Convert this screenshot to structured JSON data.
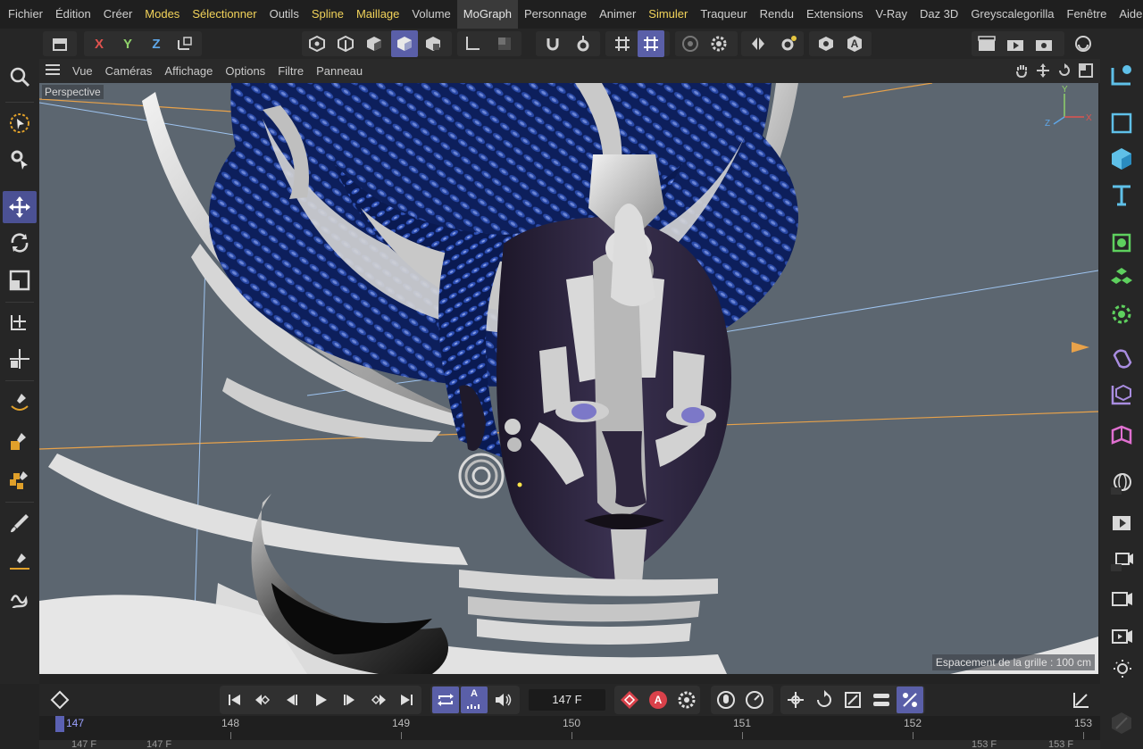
{
  "menu": [
    "Fichier",
    "Édition",
    "Créer",
    "Modes",
    "Sélectionner",
    "Outils",
    "Spline",
    "Maillage",
    "Volume",
    "MoGraph",
    "Personnage",
    "Animer",
    "Simuler",
    "Traqueur",
    "Rendu",
    "Extensions",
    "V-Ray",
    "Daz 3D",
    "Greyscalegorilla",
    "Fenêtre",
    "Aide"
  ],
  "toolbar": {
    "x_label": "X",
    "y_label": "Y",
    "z_label": "Z",
    "a_label": "A"
  },
  "viewport_menu": [
    "Vue",
    "Caméras",
    "Affichage",
    "Options",
    "Filtre",
    "Panneau"
  ],
  "viewport": {
    "camera_label": "Perspective",
    "space_label": "Espacement de la grille : 100 cm",
    "axis_y": "Y",
    "axis_x": "X",
    "axis_z": "Z"
  },
  "timeline": {
    "current_frame": "147 F",
    "record_label": "A",
    "auto_label": "A"
  },
  "ruler": {
    "ticks": [
      "148",
      "149",
      "150",
      "151",
      "152",
      "153"
    ],
    "playhead": "147"
  },
  "bottom_values": [
    "147 F",
    "147 F",
    "153 F",
    "153 F"
  ],
  "colors": {
    "accent": "#5a5fa8",
    "menu_yellow": "#f2d35a",
    "viewport_bg": "#5c6670",
    "hair_blue": "#1f3a8c",
    "skin_dark": "#2c2540"
  }
}
